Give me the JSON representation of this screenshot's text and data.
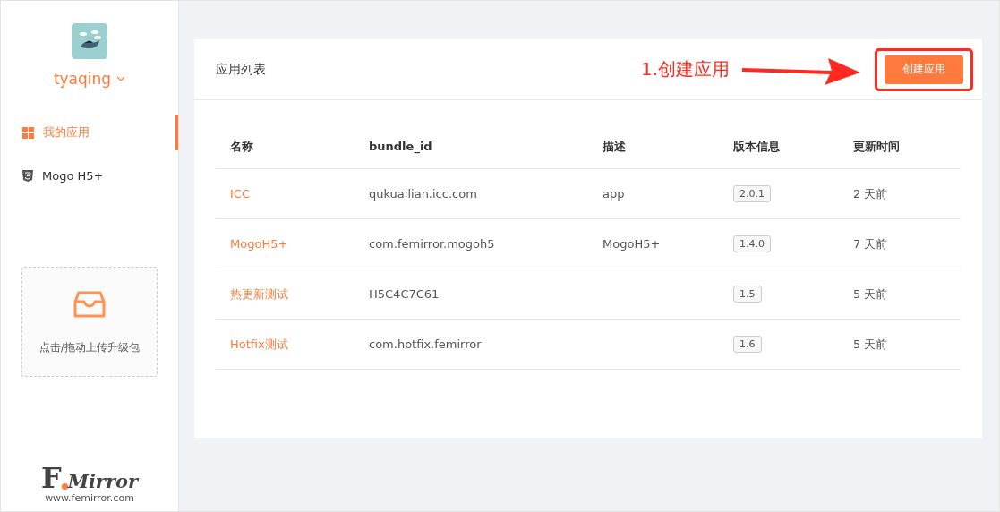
{
  "sidebar": {
    "user": {
      "name": "tyaqing"
    },
    "items": [
      {
        "label": "我的应用",
        "kind": "apps",
        "selected": true
      },
      {
        "label": "Mogo H5+",
        "kind": "h5",
        "selected": false
      }
    ],
    "upload": {
      "label": "点击/拖动上传升级包"
    },
    "logo": {
      "letter": "F",
      "word": "Mirror",
      "url": "www.femirror.com"
    }
  },
  "card": {
    "title": "应用列表",
    "annotation": "1.创建应用",
    "button": "创建应用",
    "table": {
      "columns": [
        "名称",
        "bundle_id",
        "描述",
        "版本信息",
        "更新时间"
      ],
      "rows": [
        {
          "name": "ICC",
          "bundle_id": "qukuailian.icc.com",
          "description": "app",
          "version": "2.0.1",
          "updated": "2 天前"
        },
        {
          "name": "MogoH5+",
          "bundle_id": "com.femirror.mogoh5",
          "description": "MogoH5+",
          "version": "1.4.0",
          "updated": "7 天前"
        },
        {
          "name": "热更新测试",
          "bundle_id": "H5C4C7C61",
          "version": "1.5",
          "updated": "5 天前"
        },
        {
          "name": "Hotfix测试",
          "bundle_id": "com.hotfix.femirror",
          "version": "1.6",
          "updated": "5 天前"
        }
      ]
    }
  }
}
